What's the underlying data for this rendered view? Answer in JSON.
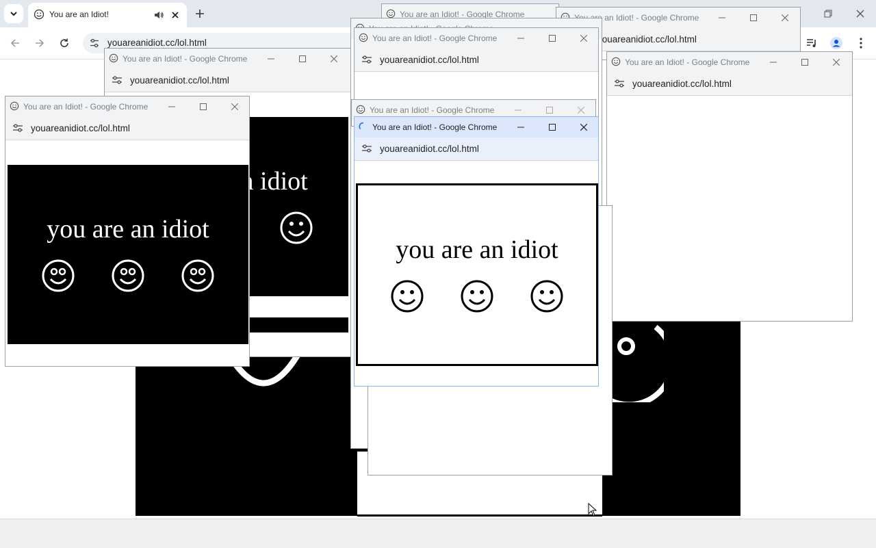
{
  "browser": {
    "tab_title": "You are an Idiot!",
    "url": "youareanidiot.cc/lol.html"
  },
  "popup": {
    "window_title": "You are an Idiot! - Google Chrome",
    "url": "youareanidiot.cc/lol.html",
    "message": "you are an idiot"
  },
  "colors": {
    "black": "#000000",
    "white": "#ffffff",
    "chrome_frame": "#e3e8ee",
    "active_titlebar": "#dce7fb",
    "loading_spinner": "#1a73e8"
  },
  "icons": [
    "smiley-icon",
    "speaker-icon",
    "close-icon",
    "plus-icon",
    "chevron-down-icon",
    "back-arrow-icon",
    "forward-arrow-icon",
    "reload-icon",
    "tune-icon",
    "minimize-icon",
    "maximize-icon",
    "restore-icon",
    "media-icon",
    "profile-icon",
    "kebab-menu-icon",
    "spinner-icon",
    "cursor-icon"
  ]
}
